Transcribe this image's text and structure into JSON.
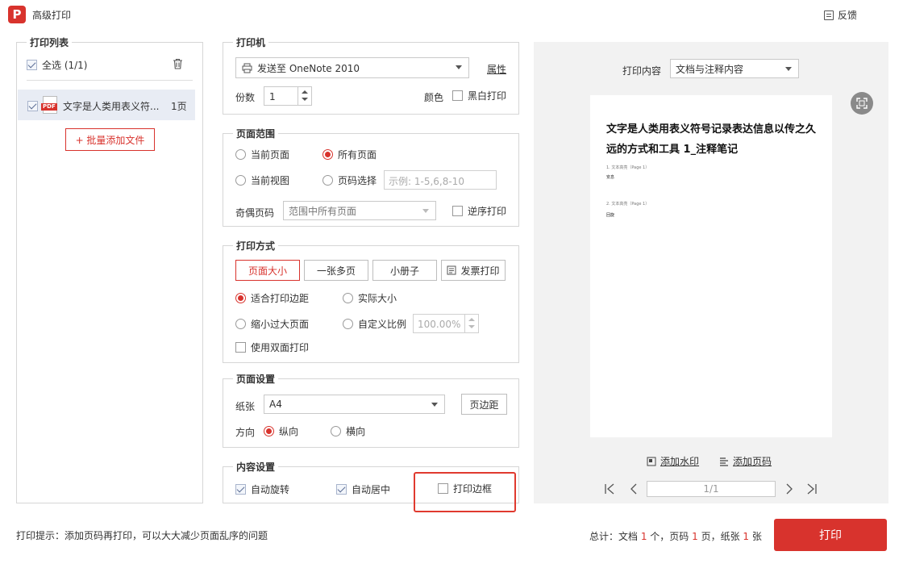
{
  "window": {
    "title": "高级打印",
    "feedback": "反馈",
    "logo_letter": "P"
  },
  "print_list": {
    "title": "打印列表",
    "select_all": "全选 (1/1)",
    "file": {
      "name": "文字是人类用表义符...",
      "pages": "1页",
      "type": "PDF"
    },
    "batch_add": "+ 批量添加文件"
  },
  "printer": {
    "title": "打印机",
    "selected": "发送至 OneNote 2010",
    "properties": "属性",
    "copies_label": "份数",
    "copies_value": "1",
    "color_label": "颜色",
    "bw_print": "黑白打印"
  },
  "page_range": {
    "title": "页面范围",
    "current_page": "当前页面",
    "all_pages": "所有页面",
    "current_view": "当前视图",
    "page_select": "页码选择",
    "page_select_placeholder": "示例: 1-5,6,8-10",
    "odd_even_label": "奇偶页码",
    "odd_even_value": "范围中所有页面",
    "reverse_print": "逆序打印"
  },
  "print_mode": {
    "title": "打印方式",
    "buttons": [
      "页面大小",
      "一张多页",
      "小册子",
      "发票打印"
    ],
    "fit_margin": "适合打印边距",
    "actual_size": "实际大小",
    "shrink_large": "缩小过大页面",
    "custom_scale": "自定义比例",
    "scale_value": "100.00%",
    "duplex": "使用双面打印"
  },
  "page_setup": {
    "title": "页面设置",
    "paper_label": "纸张",
    "paper_value": "A4",
    "margins": "页边距",
    "orientation_label": "方向",
    "portrait": "纵向",
    "landscape": "横向"
  },
  "content_setup": {
    "title": "内容设置",
    "auto_rotate": "自动旋转",
    "auto_center": "自动居中",
    "print_border": "打印边框"
  },
  "preview": {
    "content_label": "打印内容",
    "content_value": "文档与注释内容",
    "page_title_line1": "文字是人类用表义符号记录表达信息以传之久",
    "page_title_line2": "远的方式和工具 1_注释笔记",
    "note1_header": "1. 文本高亮（Page 1）",
    "note1_text": "安息",
    "note2_header": "2. 文本高亮（Page 1）",
    "note2_text": "回旋",
    "add_watermark": "添加水印",
    "add_page_number": "添加页码",
    "page_indicator": "1/1"
  },
  "footer": {
    "tip": "打印提示：添加页码再打印，可以大大减少页面乱序的问题",
    "summary_prefix": "总计：文档 ",
    "doc_count": "1",
    "summary_mid1": " 个，页码 ",
    "page_count": "1",
    "summary_mid2": " 页，纸张 ",
    "paper_count": "1",
    "summary_suffix": " 张",
    "print_button": "打印"
  },
  "colors": {
    "accent": "#d8332d",
    "highlight_box": "#e03a2f",
    "panel_bg": "#f2f2f2"
  }
}
